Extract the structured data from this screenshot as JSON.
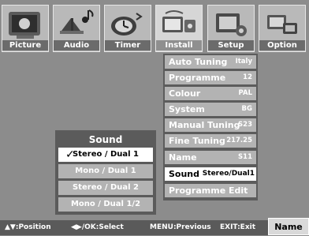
{
  "tabs": [
    {
      "label": "Picture",
      "icon": "picture-icon"
    },
    {
      "label": "Audio",
      "icon": "audio-icon"
    },
    {
      "label": "Timer",
      "icon": "timer-icon"
    },
    {
      "label": "Install",
      "icon": "install-icon"
    },
    {
      "label": "Setup",
      "icon": "setup-icon"
    },
    {
      "label": "Option",
      "icon": "option-icon"
    }
  ],
  "install_menu": {
    "items": [
      {
        "label": "Auto Tuning",
        "value": "Italy"
      },
      {
        "label": "Programme",
        "value": "12"
      },
      {
        "label": "Colour",
        "value": "PAL"
      },
      {
        "label": "System",
        "value": "BG"
      },
      {
        "label": "Manual Tuning",
        "value": "S23"
      },
      {
        "label": "Fine Tuning",
        "value": "217.25"
      },
      {
        "label": "Name",
        "value": "S11"
      },
      {
        "label": "Sound",
        "value": "Stereo/Dual1"
      },
      {
        "label": "Programme Edit",
        "value": ""
      }
    ],
    "selected_index": 7
  },
  "sound_menu": {
    "title": "Sound",
    "options": [
      "Stereo / Dual 1",
      "Mono / Dual 1",
      "Stereo / Dual 2",
      "Mono / Dual 1/2"
    ],
    "selected_index": 0
  },
  "bottom_bar": {
    "position_hint": "▲▼:Position",
    "select_hint": "◀▶/OK:Select",
    "previous_hint": "MENU:Previous",
    "exit_hint": "EXIT:Exit",
    "context_label": "Name"
  }
}
